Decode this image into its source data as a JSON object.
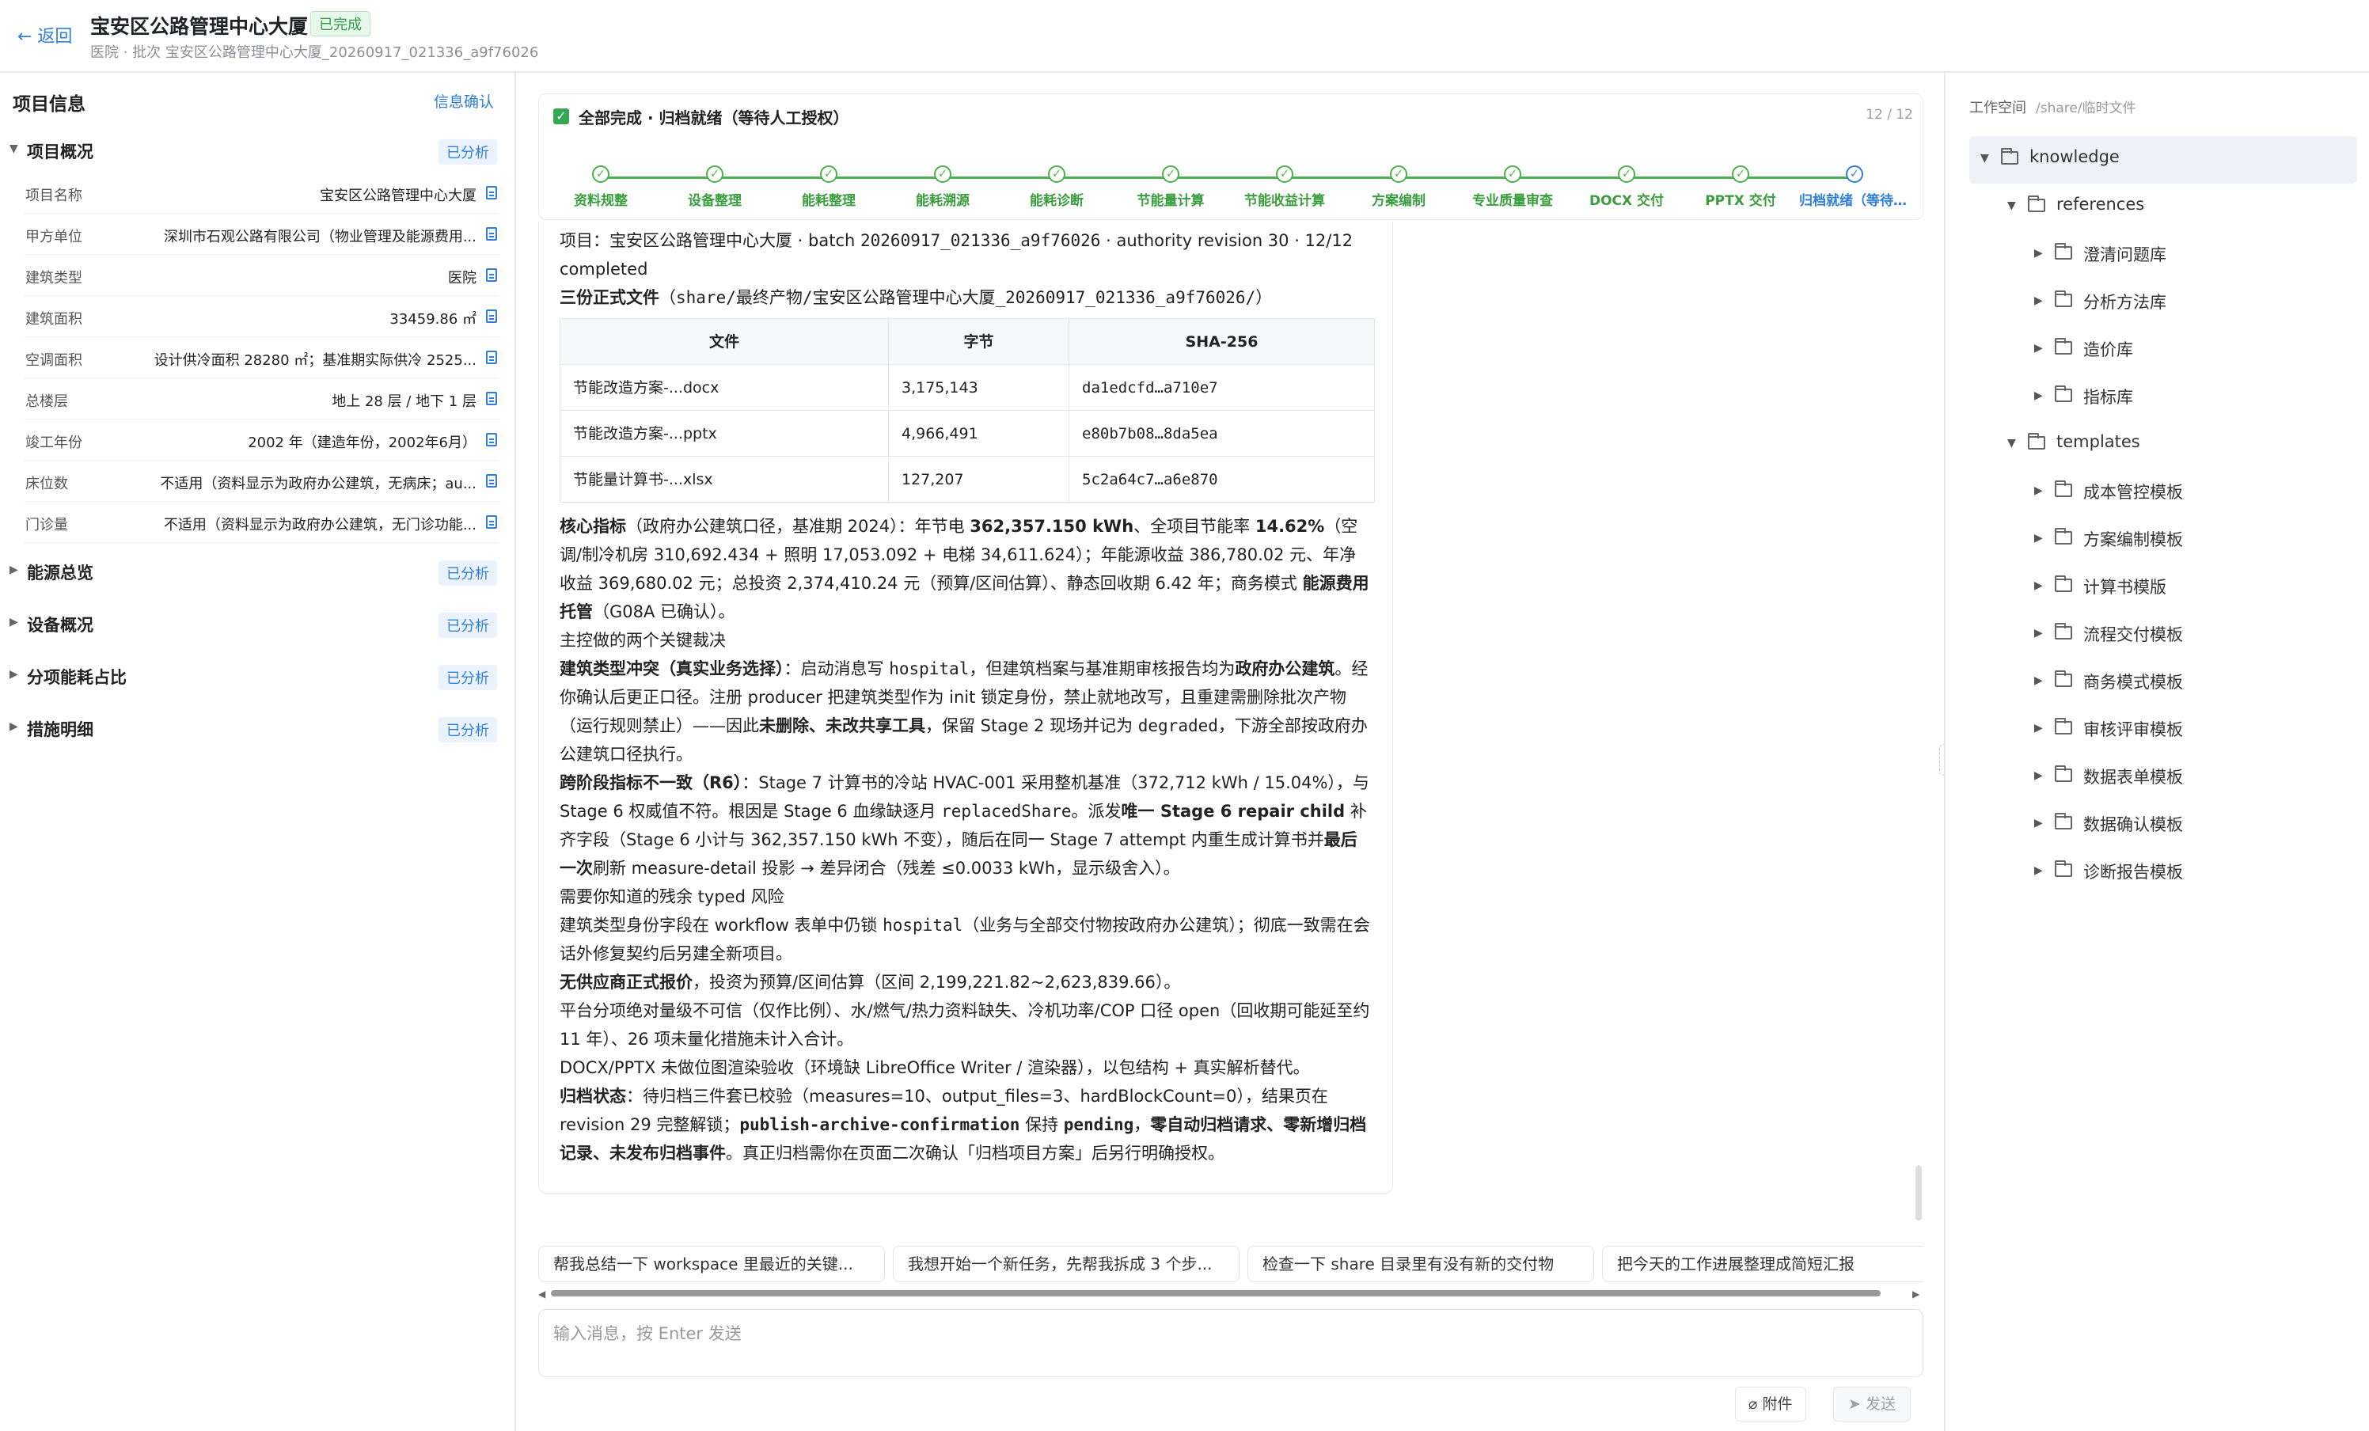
{
  "header": {
    "back": "← 返回",
    "title": "宝安区公路管理中心大厦",
    "badge": "已完成",
    "subtitle": "医院 · 批次 宝安区公路管理中心大厦_20260917_021336_a9f76026"
  },
  "left": {
    "title": "项目信息",
    "confirm": "信息确认",
    "sections": [
      {
        "label": "项目概况",
        "badge": "已分析",
        "expanded": true
      },
      {
        "label": "能源总览",
        "badge": "已分析"
      },
      {
        "label": "设备概况",
        "badge": "已分析"
      },
      {
        "label": "分项能耗占比",
        "badge": "已分析"
      },
      {
        "label": "措施明细",
        "badge": "已分析"
      }
    ],
    "rows": [
      {
        "k": "项目名称",
        "v": "宝安区公路管理中心大厦"
      },
      {
        "k": "甲方单位",
        "v": "深圳市石观公路有限公司（物业管理及能源费用..."
      },
      {
        "k": "建筑类型",
        "v": "医院"
      },
      {
        "k": "建筑面积",
        "v": "33459.86 ㎡"
      },
      {
        "k": "空调面积",
        "v": "设计供冷面积 28280 ㎡；基准期实际供冷 2525..."
      },
      {
        "k": "总楼层",
        "v": "地上 28 层 / 地下 1 层"
      },
      {
        "k": "竣工年份",
        "v": "2002 年（建造年份，2002年6月）"
      },
      {
        "k": "床位数",
        "v": "不适用（资料显示为政府办公建筑，无病床；au..."
      },
      {
        "k": "门诊量",
        "v": "不适用（资料显示为政府办公建筑，无门诊功能..."
      }
    ]
  },
  "status": {
    "title": "全部完成 · 归档就绪（等待人工授权）",
    "count": "12 / 12",
    "steps": [
      "资料规整",
      "设备整理",
      "能耗整理",
      "能耗溯源",
      "能耗诊断",
      "节能量计算",
      "节能收益计算",
      "方案编制",
      "专业质量审查",
      "DOCX 交付",
      "PPTX 交付",
      "归档就绪（等待人工授权）"
    ]
  },
  "message": {
    "l1a": "项目：宝安区公路管理中心大厦 · batch ",
    "l1b": "20260917_021336_a9f76026",
    "l1c": " · authority revision 30 · 12/12 completed",
    "l2a": "三份正式文件",
    "l2b": "（",
    "l2c": "share/最终产物/宝安区公路管理中心大厦_20260917_021336_a9f76026/",
    "l2d": "）",
    "table_headers": [
      "文件",
      "字节",
      "SHA-256"
    ],
    "table_rows": [
      [
        "节能改造方案-...docx",
        "3,175,143",
        "da1edcfd…a710e7"
      ],
      [
        "节能改造方案-...pptx",
        "4,966,491",
        "e80b7b08…8da5ea"
      ],
      [
        "节能量计算书-...xlsx",
        "127,207",
        "5c2a64c7…a6e870"
      ]
    ],
    "p1": [
      "核心指标",
      "（政府办公建筑口径，基准期 2024）：年节电 ",
      "362,357.150 kWh",
      "、全项目节能率 ",
      "14.62%",
      "（空调/制冷机房 310,692.434 + 照明 17,053.092 + 电梯 34,611.624）；年能源收益 386,780.02 元、年净收益 369,680.02 元；总投资 2,374,410.24 元（预算/区间估算）、静态回收期 6.42 年；商务模式 ",
      "能源费用托管",
      "（G08A 已确认）。"
    ],
    "p2": "主控做的两个关键裁决",
    "p3": [
      "建筑类型冲突（真实业务选择）",
      "：启动消息写 ",
      "hospital",
      "，但建筑档案与基准期审核报告均为",
      "政府办公建筑",
      "。经你确认后更正口径。注册 producer 把建筑类型作为 init 锁定身份，禁止就地改写，且重建需删除批次产物（运行规则禁止）——因此",
      "未删除、未改共享工具",
      "，保留 Stage 2 现场并记为 ",
      "degraded",
      "，下游全部按政府办公建筑口径执行。"
    ],
    "p4": [
      "跨阶段指标不一致（R6）",
      "：Stage 7 计算书的冷站 HVAC-001 采用整机基准（372,712 kWh / 15.04%），与 Stage 6 权威值不符。根因是 Stage 6 血缘缺逐月 ",
      "replacedShare",
      "。派发",
      "唯一 Stage 6 repair child",
      " 补齐字段（Stage 6 小计与 362,357.150 kWh 不变），随后在同一 Stage 7 attempt 内重生成计算书并",
      "最后一次",
      "刷新 measure-detail 投影 → 差异闭合（残差 ≤0.0033 kWh，显示级舍入）。"
    ],
    "p5": "需要你知道的残余 typed 风险",
    "p6": [
      "建筑类型身份字段在 workflow 表单中仍锁 ",
      "hospital",
      "（业务与全部交付物按政府办公建筑）；彻底一致需在会话外修复契约后另建全新项目。"
    ],
    "p7": [
      "无供应商正式报价",
      "，投资为预算/区间估算（区间 2,199,221.82~2,623,839.66）。"
    ],
    "p8": "平台分项绝对量级不可信（仅作比例）、水/燃气/热力资料缺失、冷机功率/COP 口径 open（回收期可能延至约 11 年）、26 项未量化措施未计入合计。",
    "p9": "DOCX/PPTX 未做位图渲染验收（环境缺 LibreOffice Writer / 渲染器），以包结构 + 真实解析替代。",
    "p10": [
      "归档状态",
      "：待归档三件套已校验（measures=10、output_files=3、hardBlockCount=0），结果页在 revision 29 完整解锁；",
      "publish-archive-confirmation",
      " 保持 ",
      "pending",
      "，",
      "零自动归档请求、零新增归档记录、未发布归档事件",
      "。真正归档需你在页面二次确认「归档项目方案」后另行明确授权。"
    ]
  },
  "suggestions": [
    "帮我总结一下 workspace 里最近的关键...",
    "我想开始一个新任务，先帮我拆成 3 个步...",
    "检查一下 share 目录里有没有新的交付物",
    "把今天的工作进展整理成简短汇报"
  ],
  "input": {
    "placeholder": "输入消息，按 Enter 发送",
    "attach": "附件",
    "send": "发送"
  },
  "workspace": {
    "title": "工作空间",
    "path": "/share/临时文件",
    "tree": [
      {
        "label": "knowledge",
        "depth": 0,
        "open": true,
        "sel": true
      },
      {
        "label": "references",
        "depth": 1,
        "open": true
      },
      {
        "label": "澄清问题库",
        "depth": 2
      },
      {
        "label": "分析方法库",
        "depth": 2
      },
      {
        "label": "造价库",
        "depth": 2
      },
      {
        "label": "指标库",
        "depth": 2
      },
      {
        "label": "templates",
        "depth": 1,
        "open": true
      },
      {
        "label": "成本管控模板",
        "depth": 2
      },
      {
        "label": "方案编制模板",
        "depth": 2
      },
      {
        "label": "计算书模版",
        "depth": 2
      },
      {
        "label": "流程交付模板",
        "depth": 2
      },
      {
        "label": "商务模式模板",
        "depth": 2
      },
      {
        "label": "审核评审模板",
        "depth": 2
      },
      {
        "label": "数据表单模板",
        "depth": 2
      },
      {
        "label": "数据确认模板",
        "depth": 2
      },
      {
        "label": "诊断报告模板",
        "depth": 2
      }
    ]
  }
}
